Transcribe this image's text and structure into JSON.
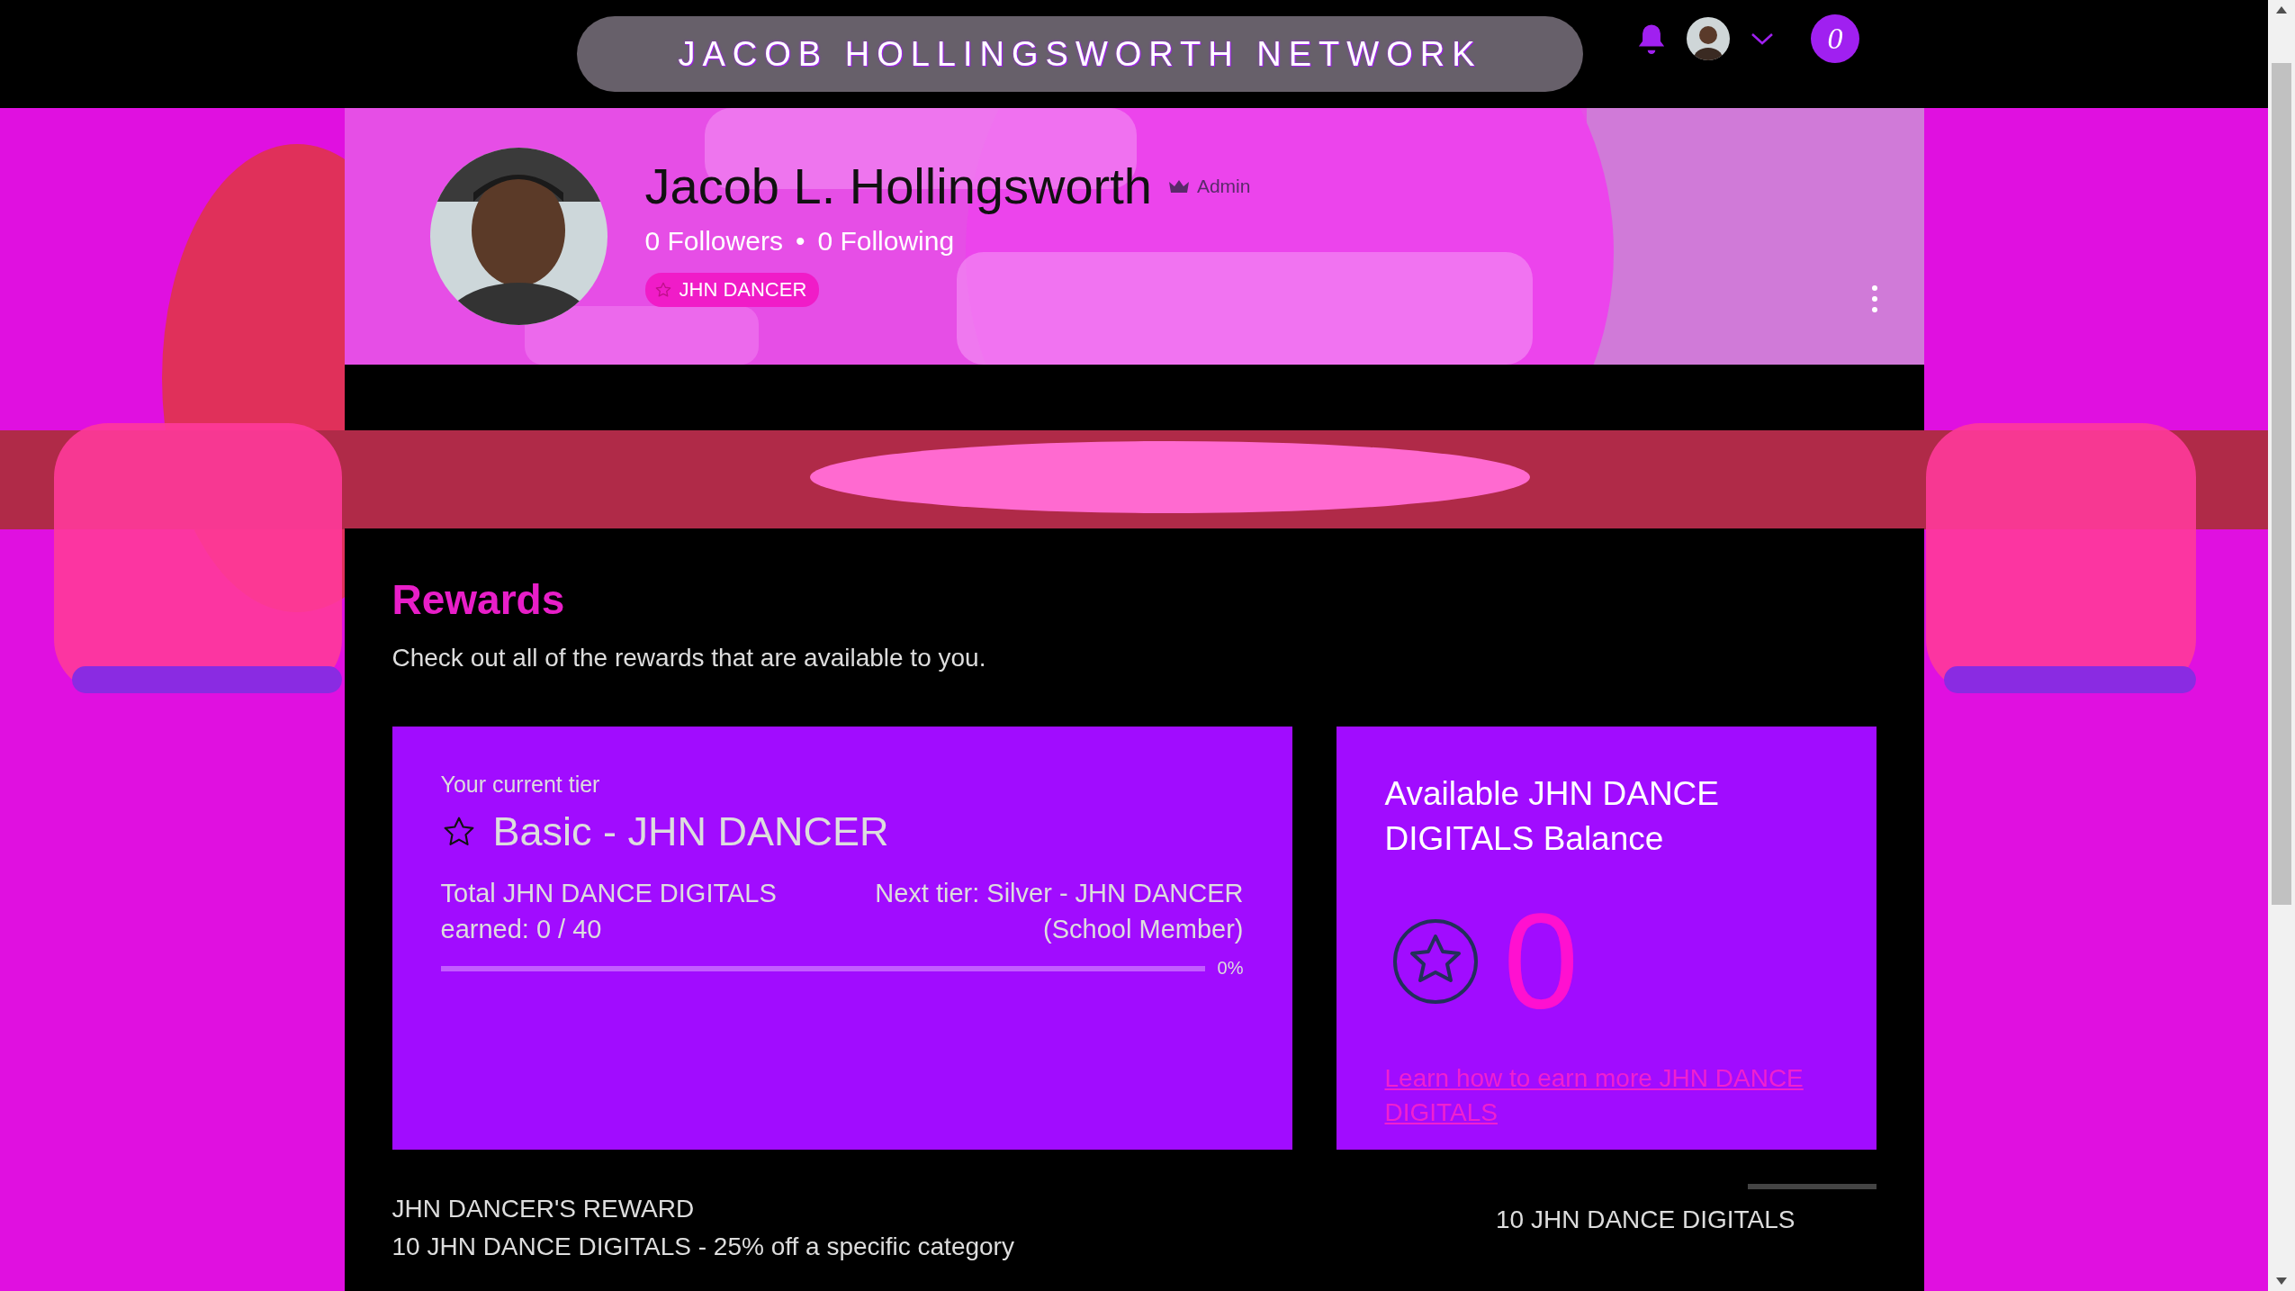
{
  "header": {
    "title": "JACOB HOLLINGSWORTH NETWORK",
    "points_badge": "0"
  },
  "profile": {
    "name": "Jacob L. Hollingsworth",
    "role": "Admin",
    "followers": "0 Followers",
    "separator": "•",
    "following": "0 Following",
    "badge": "JHN DANCER"
  },
  "rewards": {
    "title": "Rewards",
    "subtitle": "Check out all of the rewards that are available to you.",
    "tier_card": {
      "label": "Your current tier",
      "tier": "Basic - JHN DANCER",
      "earned": "Total JHN DANCE DIGITALS earned: 0 / 40",
      "next_tier": "Next tier: Silver - JHN DANCER (School Member)",
      "progress": {
        "level": 0,
        "reading": "0%"
      }
    },
    "balance_card": {
      "title": "Available JHN DANCE DIGITALS Balance",
      "amount": "0",
      "link": "Learn how to earn more JHN DANCE DIGITALS"
    }
  },
  "reward_list": [
    {
      "title": "JHN DANCER'S REWARD",
      "description": "10 JHN DANCE DIGITALS - 25% off a specific category",
      "cost": "10 JHN DANCE DIGITALS"
    }
  ]
}
